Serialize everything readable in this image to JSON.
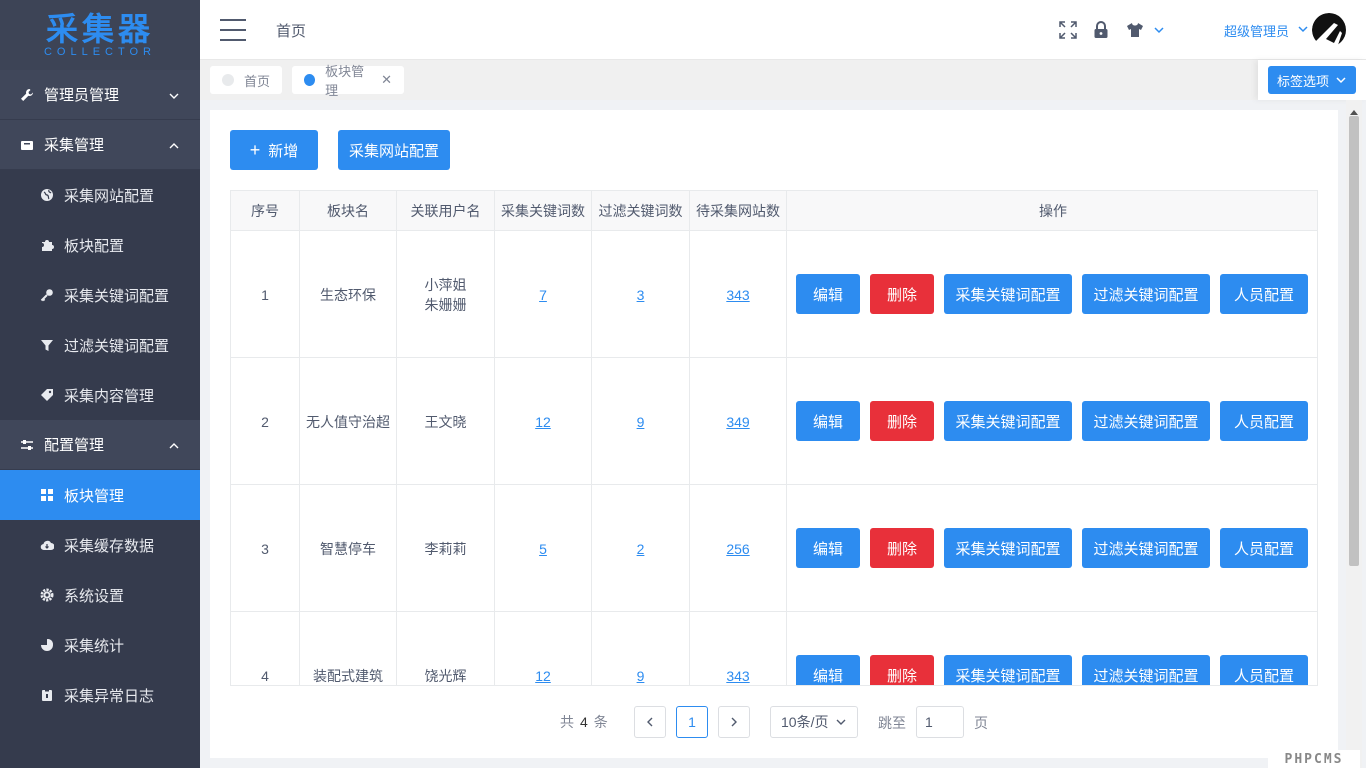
{
  "logo": {
    "title": "采集器",
    "subtitle": "COLLECTOR"
  },
  "sidebar": {
    "groups": [
      {
        "label": "管理员管理",
        "icon": "wrench-icon",
        "expanded": false,
        "items": []
      },
      {
        "label": "采集管理",
        "icon": "inbox-icon",
        "expanded": true,
        "items": [
          {
            "label": "采集网站配置",
            "icon": "globe-icon"
          },
          {
            "label": "板块配置",
            "icon": "puzzle-icon"
          },
          {
            "label": "采集关键词配置",
            "icon": "key-icon"
          },
          {
            "label": "过滤关键词配置",
            "icon": "filter-icon"
          },
          {
            "label": "采集内容管理",
            "icon": "tag-icon"
          }
        ]
      },
      {
        "label": "配置管理",
        "icon": "sliders-icon",
        "expanded": true,
        "items": [
          {
            "label": "板块管理",
            "icon": "grid-icon",
            "active": true
          },
          {
            "label": "采集缓存数据",
            "icon": "cloud-icon"
          },
          {
            "label": "系统设置",
            "icon": "gear-icon"
          },
          {
            "label": "采集统计",
            "icon": "pie-icon"
          },
          {
            "label": "采集异常日志",
            "icon": "clipboard-icon"
          }
        ]
      }
    ]
  },
  "header": {
    "breadcrumb": "首页",
    "user": "超级管理员",
    "icons": [
      "fullscreen-icon",
      "lock-icon",
      "tshirt-icon",
      "chevron-down-icon"
    ]
  },
  "tabs": {
    "items": [
      {
        "label": "首页",
        "active": false
      },
      {
        "label": "板块管理",
        "active": true
      }
    ],
    "options_label": "标签选项"
  },
  "toolbar": {
    "add_label": "新增",
    "site_config_label": "采集网站配置"
  },
  "table": {
    "columns": [
      "序号",
      "板块名",
      "关联用户名",
      "采集关键词数",
      "过滤关键词数",
      "待采集网站数",
      "操作"
    ],
    "actions": [
      "编辑",
      "删除",
      "采集关键词配置",
      "过滤关键词配置",
      "人员配置"
    ],
    "rows": [
      {
        "index": "1",
        "name": "生态环保",
        "users": [
          "小萍姐",
          "朱姗姗"
        ],
        "collect_kw": "7",
        "filter_kw": "3",
        "sites": "343"
      },
      {
        "index": "2",
        "name": "无人值守治超",
        "users": [
          "王文晓"
        ],
        "collect_kw": "12",
        "filter_kw": "9",
        "sites": "349"
      },
      {
        "index": "3",
        "name": "智慧停车",
        "users": [
          "李莉莉"
        ],
        "collect_kw": "5",
        "filter_kw": "2",
        "sites": "256"
      },
      {
        "index": "4",
        "name": "装配式建筑",
        "users": [
          "饶光辉"
        ],
        "collect_kw": "12",
        "filter_kw": "9",
        "sites": "343"
      }
    ]
  },
  "pagination": {
    "total_prefix": "共",
    "total": "4",
    "total_suffix": "条",
    "current_page": "1",
    "page_size": "10条/页",
    "jump_label": "跳至",
    "jump_value": "1",
    "jump_suffix": "页"
  },
  "watermark": "PHPCMS",
  "colors": {
    "primary": "#2d8cf0",
    "danger": "#e8303a",
    "sidebar": "#353b4d"
  }
}
